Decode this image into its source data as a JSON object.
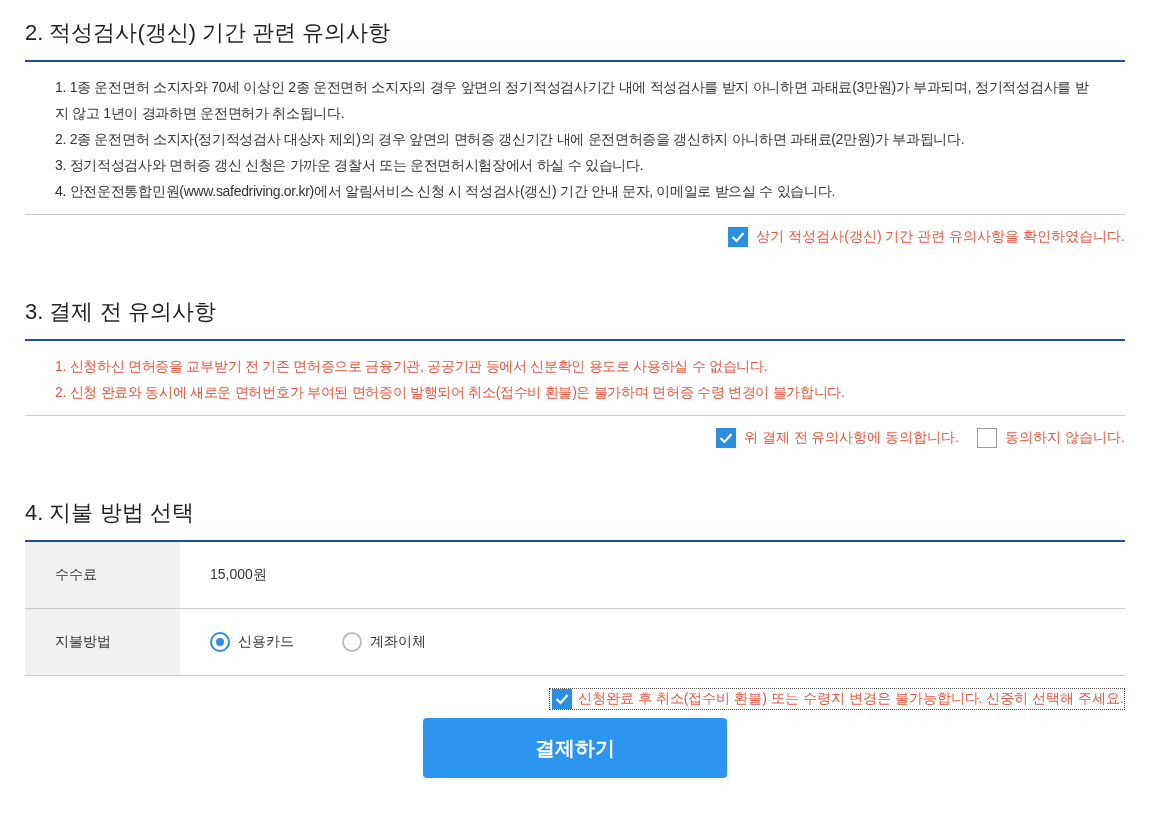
{
  "sections": [
    {
      "title": "2. 적성검사(갱신) 기간 관련 유의사항",
      "kind": "normal",
      "notes": [
        "1. 1종 운전면허 소지자와 70세 이상인 2종 운전면허 소지자의 경우 앞면의 정기적성검사기간 내에 적성검사를 받지 아니하면 과태료(3만원)가 부과되며, 정기적성검사를 받지 않고 1년이 경과하면 운전면허가 취소됩니다.",
        "2. 2종 운전면허 소지자(정기적성검사 대상자 제외)의 경우 앞면의 면허증 갱신기간 내에 운전면허증을 갱신하지 아니하면 과태료(2만원)가 부과됩니다.",
        "3. 정기적성검사와 면허증 갱신 신청은 가까운 경찰서 또는 운전면허시험장에서 하실 수 있습니다.",
        "4. 안전운전통합민원(www.safedriving.or.kr)에서 알림서비스 신청 시 적성검사(갱신) 기간 안내 문자, 이메일로 받으실 수 있습니다."
      ],
      "agreements": [
        {
          "label": "상기 적성검사(갱신) 기간 관련 유의사항을 확인하였습니다.",
          "checked": true
        }
      ]
    },
    {
      "title": "3. 결제 전 유의사항",
      "kind": "warning",
      "notes": [
        "1. 신청하신 면허증을 교부받기 전 기존 면허증으로 금융기관, 공공기관 등에서 신분확인 용도로 사용하실 수 없습니다.",
        "2. 신청 완료와 동시에 새로운 면허번호가 부여된 면허증이 발행되어 취소(접수비 환불)은 불가하며 면허증 수령 변경이 불가합니다."
      ],
      "agreements": [
        {
          "label": "위 결제 전 유의사항에 동의합니다.",
          "checked": true
        },
        {
          "label": "동의하지 않습니다.",
          "checked": false
        }
      ]
    }
  ],
  "payment": {
    "title": "4. 지불 방법 선택",
    "fee": {
      "label": "수수료",
      "value": "15,000원"
    },
    "method": {
      "label": "지불방법",
      "options": [
        {
          "label": "신용카드",
          "selected": true
        },
        {
          "label": "계좌이체",
          "selected": false
        }
      ]
    },
    "confirm": {
      "label": "신청완료 후 취소(접수비 환불) 또는 수령지 변경은 불가능합니다. 신중히 선택해 주세요.",
      "checked": true
    },
    "submit": "결제하기"
  }
}
